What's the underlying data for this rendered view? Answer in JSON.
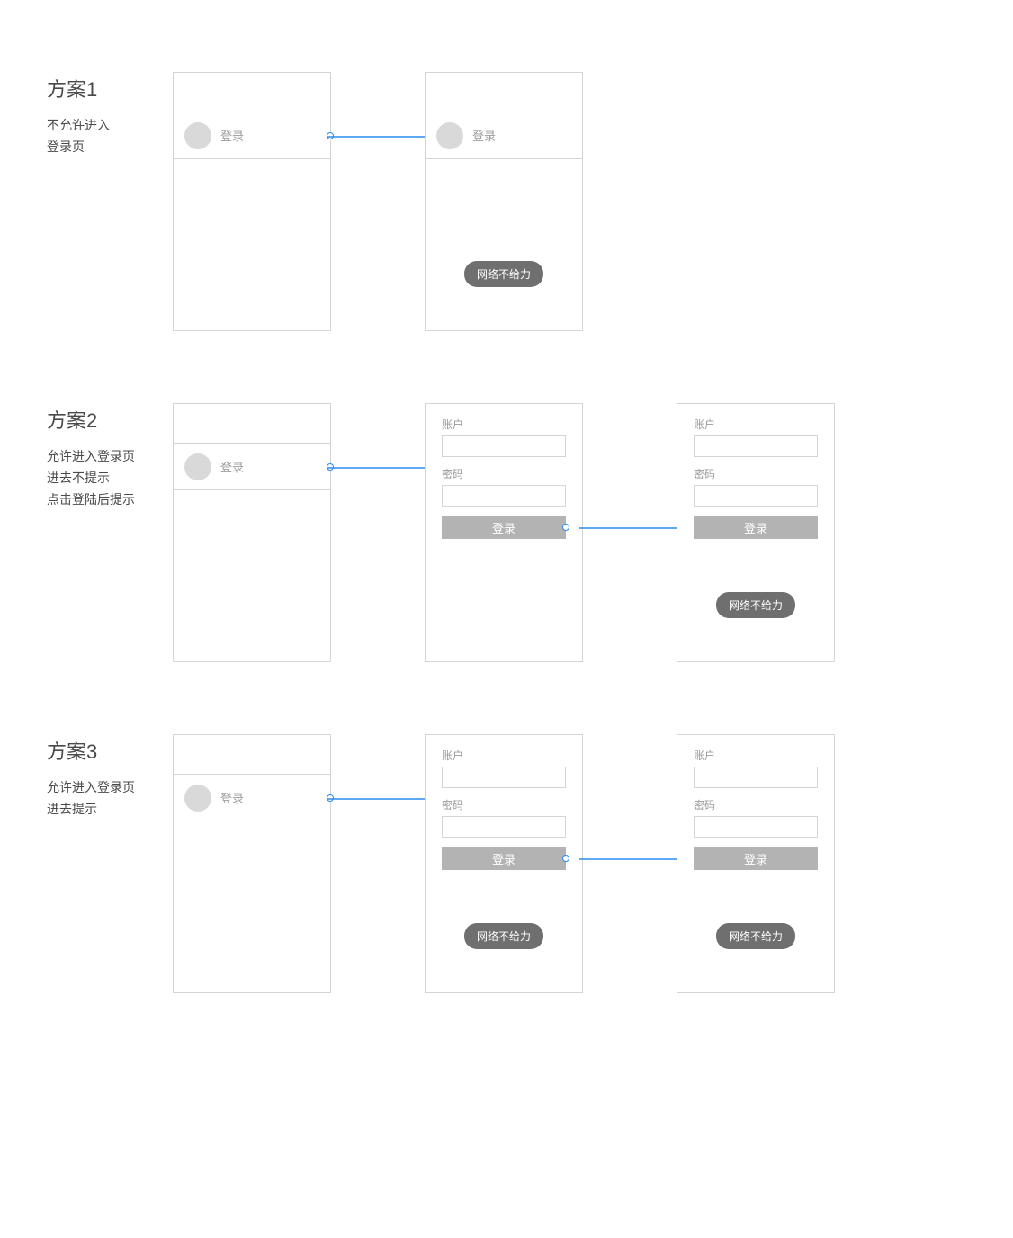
{
  "plans": {
    "p1": {
      "title": "方案1",
      "desc_line1": "不允许进入",
      "desc_line2": "登录页"
    },
    "p2": {
      "title": "方案2",
      "desc_line1": "允许进入登录页",
      "desc_line2": "进去不提示",
      "desc_line3": "点击登陆后提示"
    },
    "p3": {
      "title": "方案3",
      "desc_line1": "允许进入登录页",
      "desc_line2": "进去提示"
    }
  },
  "ui": {
    "login_label": "登录",
    "account_label": "账户",
    "password_label": "密码",
    "login_button": "登录",
    "toast_text": "网络不给力"
  },
  "colors": {
    "arrow": "#2a8cf0",
    "border": "#d5d5d5",
    "avatar": "#d9d9d9",
    "button": "#b3b3b3",
    "toast": "#6f6f6f",
    "text_muted": "#9b9b9b",
    "text": "#4a4a4a"
  }
}
